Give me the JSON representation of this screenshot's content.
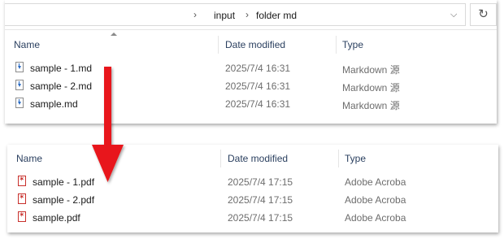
{
  "top_window": {
    "breadcrumb": [
      "input",
      "folder md"
    ],
    "columns": {
      "name": "Name",
      "date": "Date modified",
      "type": "Type"
    },
    "files": [
      {
        "name": "sample - 1.md",
        "date": "2025/7/4 16:31",
        "type": "Markdown 源",
        "icon": "markdown-file-icon"
      },
      {
        "name": "sample - 2.md",
        "date": "2025/7/4 16:31",
        "type": "Markdown 源",
        "icon": "markdown-file-icon"
      },
      {
        "name": "sample.md",
        "date": "2025/7/4 16:31",
        "type": "Markdown 源",
        "icon": "markdown-file-icon"
      }
    ]
  },
  "bottom_window": {
    "columns": {
      "name": "Name",
      "date": "Date modified",
      "type": "Type"
    },
    "files": [
      {
        "name": "sample - 1.pdf",
        "date": "2025/7/4 17:15",
        "type": "Adobe Acroba",
        "icon": "pdf-file-icon"
      },
      {
        "name": "sample - 2.pdf",
        "date": "2025/7/4 17:15",
        "type": "Adobe Acroba",
        "icon": "pdf-file-icon"
      },
      {
        "name": "sample.pdf",
        "date": "2025/7/4 17:15",
        "type": "Adobe Acroba",
        "icon": "pdf-file-icon"
      }
    ]
  },
  "colors": {
    "arrow": "#e8191a",
    "header_text": "#2a3f5f",
    "secondary_text": "#6d6d6d"
  },
  "icons": {
    "refresh": "refresh-icon",
    "dropdown": "chevron-down-icon",
    "sort": "sort-ascending-icon",
    "separator": "chevron-right-icon"
  }
}
